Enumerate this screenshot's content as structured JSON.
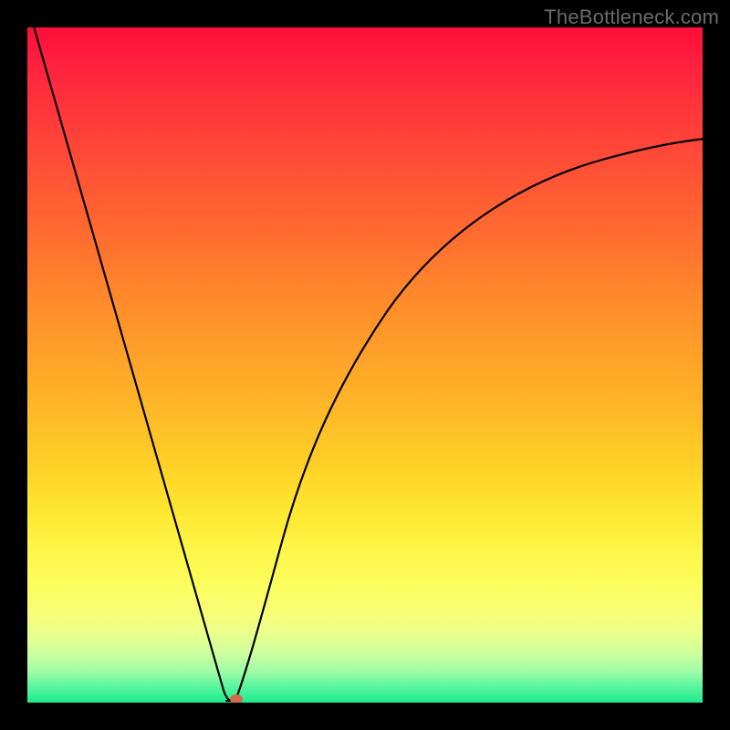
{
  "watermark": "TheBottleneck.com",
  "colors": {
    "frame": "#000000",
    "curve": "#000000",
    "marker": "#d46a4a",
    "gradient_stops": [
      "#ff0d3a",
      "#ff3f3a",
      "#ff8f2a",
      "#ffd126",
      "#fff74a",
      "#e9ff8e",
      "#5df69f",
      "#1deb8f"
    ]
  },
  "chart_data": {
    "type": "line",
    "title": "",
    "xlabel": "",
    "ylabel": "",
    "xlim": [
      0,
      100
    ],
    "ylim": [
      0,
      100
    ],
    "x": [
      0,
      5,
      10,
      15,
      20,
      25,
      27,
      28,
      29,
      30,
      32,
      35,
      40,
      45,
      50,
      55,
      60,
      65,
      70,
      75,
      80,
      85,
      90,
      95,
      100
    ],
    "y": [
      100,
      83,
      66,
      48,
      31,
      14,
      7,
      3,
      1,
      0,
      6,
      16,
      29,
      40,
      49,
      56,
      62,
      66,
      70,
      73,
      76,
      78,
      80,
      82,
      83
    ],
    "marker": {
      "x": 30,
      "y": 0
    },
    "notes": "V-shaped bottleneck curve; minimum at x≈30. Values estimated from pixel positions; no axis ticks or labels are rendered in the image."
  }
}
